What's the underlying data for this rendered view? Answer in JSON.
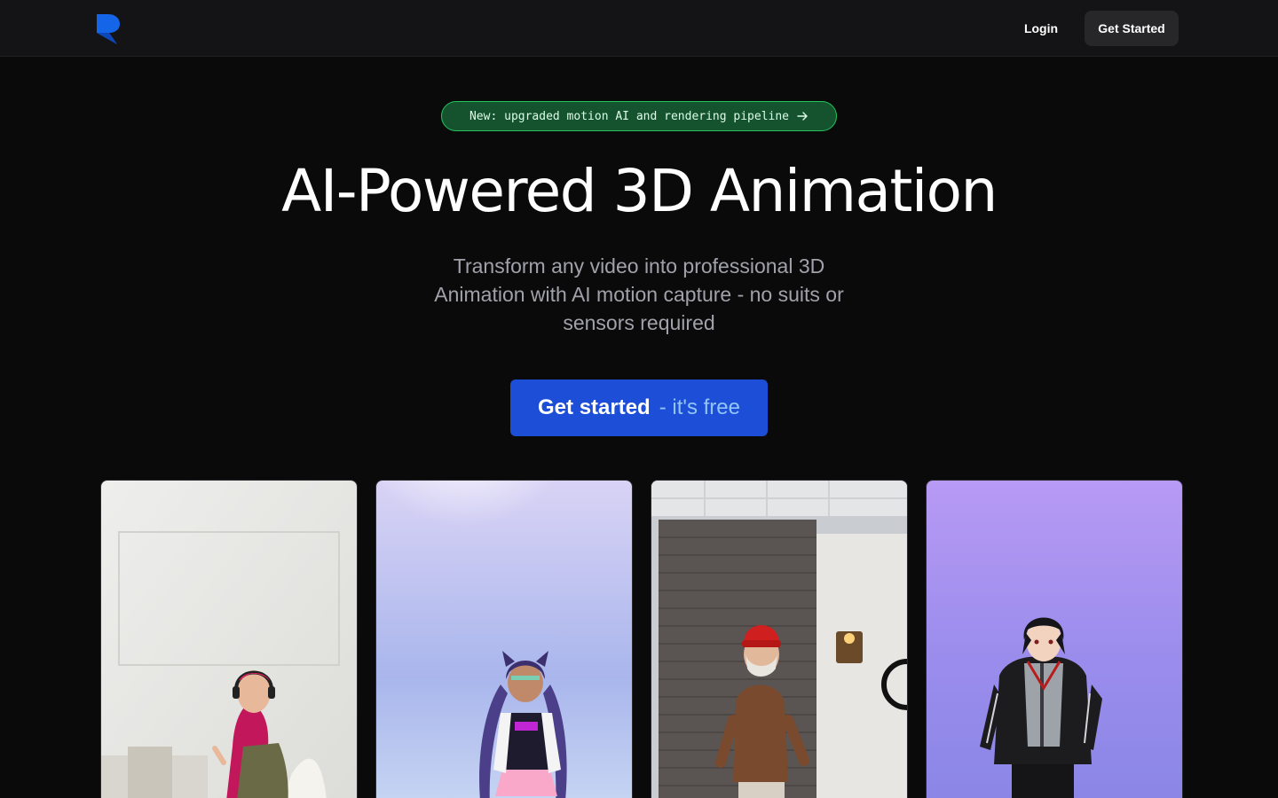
{
  "header": {
    "login_label": "Login",
    "cta_label": "Get Started"
  },
  "announcement": {
    "text": "New: upgraded motion AI and rendering pipeline"
  },
  "hero": {
    "title": "AI-Powered 3D Animation",
    "subtitle": "Transform any video into professional 3D Animation with AI motion capture - no suits or sensors required",
    "cta_strong": "Get started",
    "cta_light": "- it's free"
  },
  "colors": {
    "background": "#0a0a0b",
    "brand_blue": "#1d4ed8",
    "badge_green": "#14532d"
  },
  "cards": [
    {
      "kind": "real-person-video",
      "icon": "headphones-woman"
    },
    {
      "kind": "anime-3d-character",
      "icon": "cat-ear-girl"
    },
    {
      "kind": "real-person-video",
      "icon": "man-red-beanie"
    },
    {
      "kind": "anime-3d-character",
      "icon": "boy-jacket"
    }
  ]
}
